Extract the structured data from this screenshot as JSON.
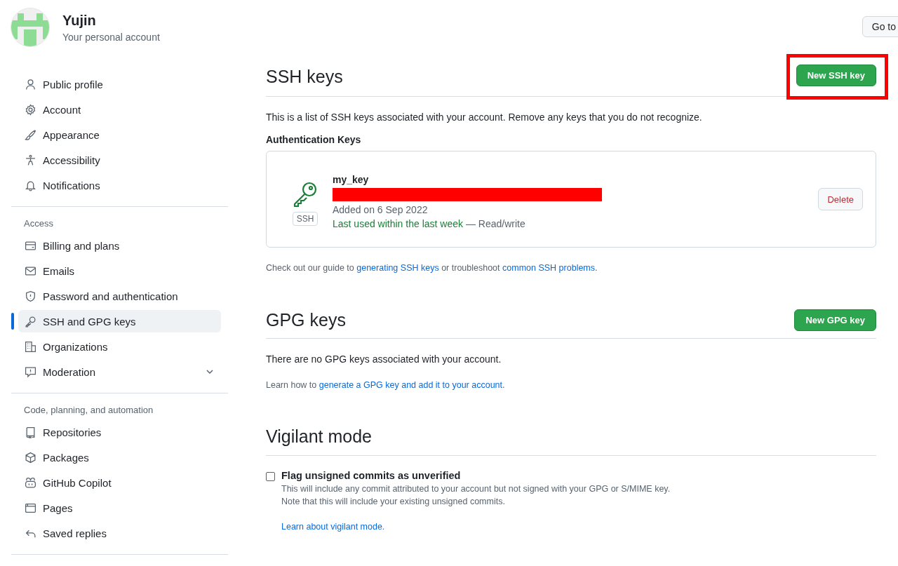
{
  "account": {
    "name": "Yujin",
    "subtitle": "Your personal account"
  },
  "header_button": "Go to",
  "sidebar": {
    "sections": [
      {
        "items": [
          {
            "label": "Public profile",
            "kind": "link",
            "selected": false
          },
          {
            "label": "Account",
            "kind": "link",
            "selected": false
          },
          {
            "label": "Appearance",
            "kind": "link",
            "selected": false
          },
          {
            "label": "Accessibility",
            "kind": "link",
            "selected": false
          },
          {
            "label": "Notifications",
            "kind": "link",
            "selected": false
          }
        ]
      },
      {
        "heading": "Access",
        "items": [
          {
            "label": "Billing and plans",
            "kind": "link",
            "selected": false
          },
          {
            "label": "Emails",
            "kind": "link",
            "selected": false
          },
          {
            "label": "Password and authentication",
            "kind": "link",
            "selected": false
          },
          {
            "label": "SSH and GPG keys",
            "kind": "link",
            "selected": true
          },
          {
            "label": "Organizations",
            "kind": "link",
            "selected": false
          },
          {
            "label": "Moderation",
            "kind": "group",
            "selected": false
          }
        ]
      },
      {
        "heading": "Code, planning, and automation",
        "items": [
          {
            "label": "Repositories",
            "kind": "link",
            "selected": false
          },
          {
            "label": "Packages",
            "kind": "link",
            "selected": false
          },
          {
            "label": "GitHub Copilot",
            "kind": "link",
            "selected": false
          },
          {
            "label": "Pages",
            "kind": "link",
            "selected": false
          },
          {
            "label": "Saved replies",
            "kind": "link",
            "selected": false
          }
        ]
      }
    ]
  },
  "ssh": {
    "title": "SSH keys",
    "button": "New SSH key",
    "description": "This is a list of SSH keys associated with your account. Remove any keys that you do not recognize.",
    "subheading": "Authentication Keys",
    "keys": [
      {
        "title": "my_key",
        "badge": "SSH",
        "added": "Added on 6 Sep 2022",
        "last_used": "Last used within the last week",
        "access": " — Read/write",
        "button": "Delete"
      }
    ],
    "help": [
      {
        "text": "Check out our guide to ",
        "link": false
      },
      {
        "text": "generating SSH keys",
        "link": true
      },
      {
        "text": " or troubleshoot ",
        "link": false
      },
      {
        "text": "common SSH problems",
        "link": true
      },
      {
        "text": ".",
        "link": false
      }
    ]
  },
  "gpg": {
    "title": "GPG keys",
    "button": "New GPG key",
    "description": "There are no GPG keys associated with your account.",
    "help": [
      {
        "text": "Learn how to ",
        "link": false
      },
      {
        "text": "generate a GPG key and add it to your account",
        "link": true
      },
      {
        "text": ".",
        "link": false
      }
    ]
  },
  "vigilant": {
    "title": "Vigilant mode",
    "option": {
      "label": "Flag unsigned commits as unverified",
      "checked": false,
      "notes": [
        "This will include any commit attributed to your account but not signed with your GPG or S/MIME key.",
        "Note that this will include your existing unsigned commits."
      ],
      "link": "Learn about vigilant mode."
    }
  }
}
